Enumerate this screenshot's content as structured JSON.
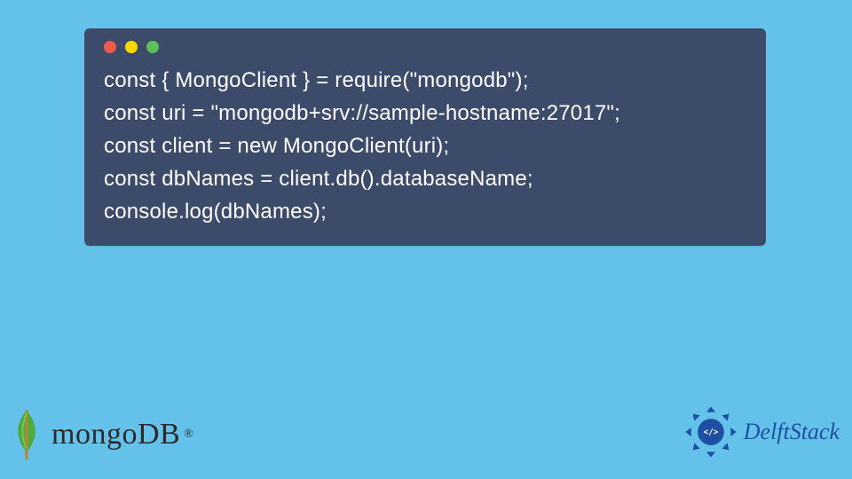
{
  "code": {
    "lines": [
      "const { MongoClient } = require(\"mongodb\");",
      "const uri = \"mongodb+srv://sample-hostname:27017\";",
      "const client = new MongoClient(uri);",
      "const dbNames = client.db().databaseName;",
      "console.log(dbNames);"
    ]
  },
  "traffic_light_colors": {
    "red": "#ed594a",
    "yellow": "#fdd800",
    "green": "#5ac05a"
  },
  "mongodb": {
    "text": "mongoDB",
    "registered": "®",
    "leaf_color": "#4faa3d"
  },
  "delftstack": {
    "text": "DelftStack",
    "badge_color": "#1f4fa3",
    "code_glyph": "</>"
  },
  "background_color": "#64c1ea",
  "code_window_bg": "#3d4b6a"
}
